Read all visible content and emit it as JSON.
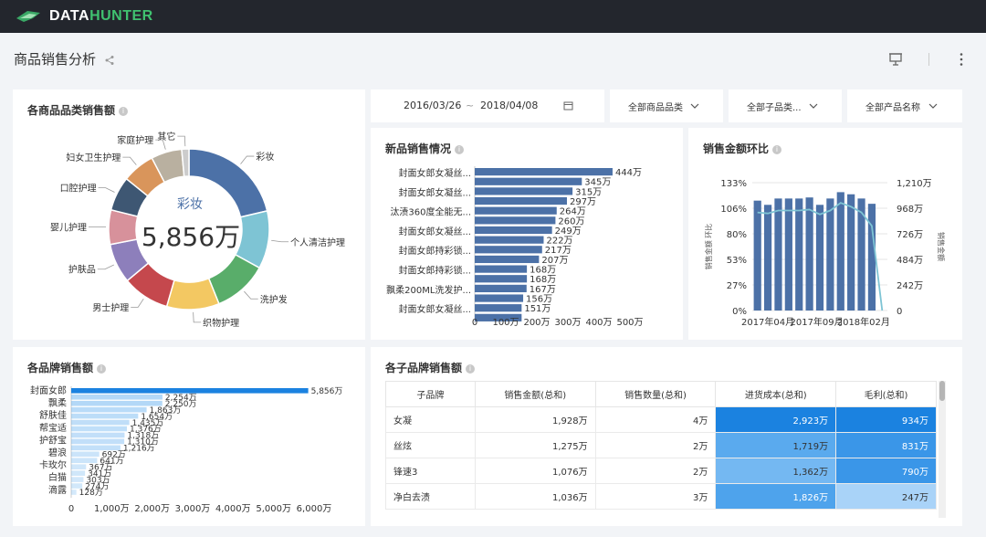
{
  "app": {
    "logo_text_a": "DATA",
    "logo_text_b": "HUNTER",
    "logo_icon": "brand-shape-icon"
  },
  "header": {
    "title": "商品销售分析",
    "share_icon": "share-icon",
    "present_icon": "presentation-icon",
    "more_icon": "more-vertical-icon"
  },
  "filters": {
    "date_start": "2016/03/26",
    "date_sep": "~",
    "date_end": "2018/04/08",
    "calendar_icon": "calendar-icon",
    "category": "全部商品品类",
    "subcategory": "全部子品类...",
    "product": "全部产品名称",
    "chevron_icon": "chevron-down-icon"
  },
  "donut": {
    "title": "各商品品类销售额",
    "center_label": "彩妆",
    "center_value": "5,856万",
    "chart_data": {
      "type": "pie",
      "title": "各商品品类销售额",
      "categories": [
        "彩妆",
        "个人清洁护理",
        "洗护发",
        "织物护理",
        "男士护理",
        "护肤品",
        "婴儿护理",
        "口腔护理",
        "妇女卫生护理",
        "家庭护理",
        "其它"
      ],
      "values": [
        5856,
        3200,
        3000,
        2900,
        2600,
        2200,
        1900,
        1900,
        1800,
        1700,
        400
      ],
      "colors": [
        "#4c71a7",
        "#7ec4d4",
        "#59ad6a",
        "#f3c862",
        "#c5484d",
        "#8d7fbb",
        "#d7919b",
        "#3e5773",
        "#d9955b",
        "#b9b0a0",
        "#cccccc"
      ]
    }
  },
  "newsales": {
    "title": "新品销售情况",
    "chart_data": {
      "type": "bar",
      "orientation": "horizontal",
      "categories": [
        "封面女郎女凝丝...",
        "",
        "封面女郎女凝丝...",
        "",
        "汰渍360度全能无...",
        "",
        "封面女郎女凝丝...",
        "",
        "封面女郎持彩锁...",
        "",
        "封面女郎持彩锁...",
        "",
        "飘柔200ML洗发护...",
        "",
        "封面女郎女凝丝...",
        ""
      ],
      "values": [
        444,
        345,
        315,
        297,
        264,
        260,
        249,
        222,
        217,
        207,
        168,
        168,
        167,
        156,
        151,
        151
      ],
      "data_labels": [
        "444万",
        "345万",
        "315万",
        "297万",
        "264万",
        "260万",
        "249万",
        "222万",
        "217万",
        "207万",
        "168万",
        "168万",
        "167万",
        "156万",
        "151万"
      ],
      "xlim": [
        0,
        500
      ],
      "xticks": [
        "0",
        "100万",
        "200万",
        "300万",
        "400万",
        "500万"
      ],
      "color": "#4c71a7"
    }
  },
  "ratio": {
    "title": "销售金额环比",
    "chart_data": {
      "type": "bar",
      "title": "销售金额环比",
      "values": [
        1040,
        1000,
        1060,
        1060,
        1060,
        1070,
        1000,
        1060,
        1120,
        1100,
        1060,
        1010,
        0
      ],
      "line": [
        102,
        101,
        104,
        104,
        104,
        105,
        100,
        104,
        112,
        108,
        102,
        88,
        0
      ],
      "ylabel": "销售金额 环比",
      "y2label": "销售金额",
      "y_left_ticks": [
        "133%",
        "106%",
        "80%",
        "53%",
        "27%",
        "0%"
      ],
      "y_right_ticks": [
        "1,210万",
        "968万",
        "726万",
        "484万",
        "242万",
        "0"
      ],
      "xticks": [
        "2017年04月",
        "2017年09月",
        "2018年02月"
      ],
      "ylim": [
        0,
        1210
      ],
      "color": "#4c71a7",
      "line_color": "#7ec4d4"
    }
  },
  "brand": {
    "title": "各品牌销售额",
    "chart_data": {
      "type": "bar",
      "orientation": "horizontal",
      "categories": [
        "封面女郎",
        "飘柔",
        "舒肤佳",
        "帮宝适",
        "护舒宝",
        "碧浪",
        "卡玫尔",
        "白猫",
        "滴露"
      ],
      "values": [
        5856,
        2254,
        2250,
        1863,
        1654,
        1435,
        1376,
        1318,
        1310,
        1216,
        692,
        641,
        367,
        341,
        303,
        274,
        128
      ],
      "data_labels": [
        "5,856万",
        "2,254万",
        "2,250万",
        "1,863万",
        "1,654万",
        "1,435万",
        "1,376万",
        "1,318万",
        "1,310万",
        "1,216万",
        "692万",
        "641万",
        "367万",
        "341万",
        "303万",
        "274万",
        "128万"
      ],
      "xlim": [
        0,
        6000
      ],
      "xticks": [
        "0",
        "1,000万",
        "2,000万",
        "3,000万",
        "4,000万",
        "5,000万",
        "6,000万"
      ]
    }
  },
  "table": {
    "title": "各子品牌销售额",
    "columns": [
      "子品牌",
      "销售金额(总和)",
      "销售数量(总和)",
      "进货成本(总和)",
      "毛利(总和)"
    ],
    "rows": [
      {
        "name": "女凝",
        "sales": "1,928万",
        "qty": "4万",
        "cost": "2,923万",
        "profit": "934万",
        "cost_color": "#1b82e0",
        "profit_color": "#1b82e0",
        "cost_txt": "#ffffff",
        "profit_txt": "#ffffff"
      },
      {
        "name": "丝炫",
        "sales": "1,275万",
        "qty": "2万",
        "cost": "1,719万",
        "profit": "831万",
        "cost_color": "#5aaaee",
        "profit_color": "#3a96e8",
        "cost_txt": "#333333",
        "profit_txt": "#ffffff"
      },
      {
        "name": "锋速3",
        "sales": "1,076万",
        "qty": "2万",
        "cost": "1,362万",
        "profit": "790万",
        "cost_color": "#74b8f2",
        "profit_color": "#3a96e8",
        "cost_txt": "#333333",
        "profit_txt": "#ffffff"
      },
      {
        "name": "净白去渍",
        "sales": "1,036万",
        "qty": "3万",
        "cost": "1,826万",
        "profit": "247万",
        "cost_color": "#4ea3ec",
        "profit_color": "#a9d3f8",
        "cost_txt": "#ffffff",
        "profit_txt": "#333333"
      }
    ]
  }
}
